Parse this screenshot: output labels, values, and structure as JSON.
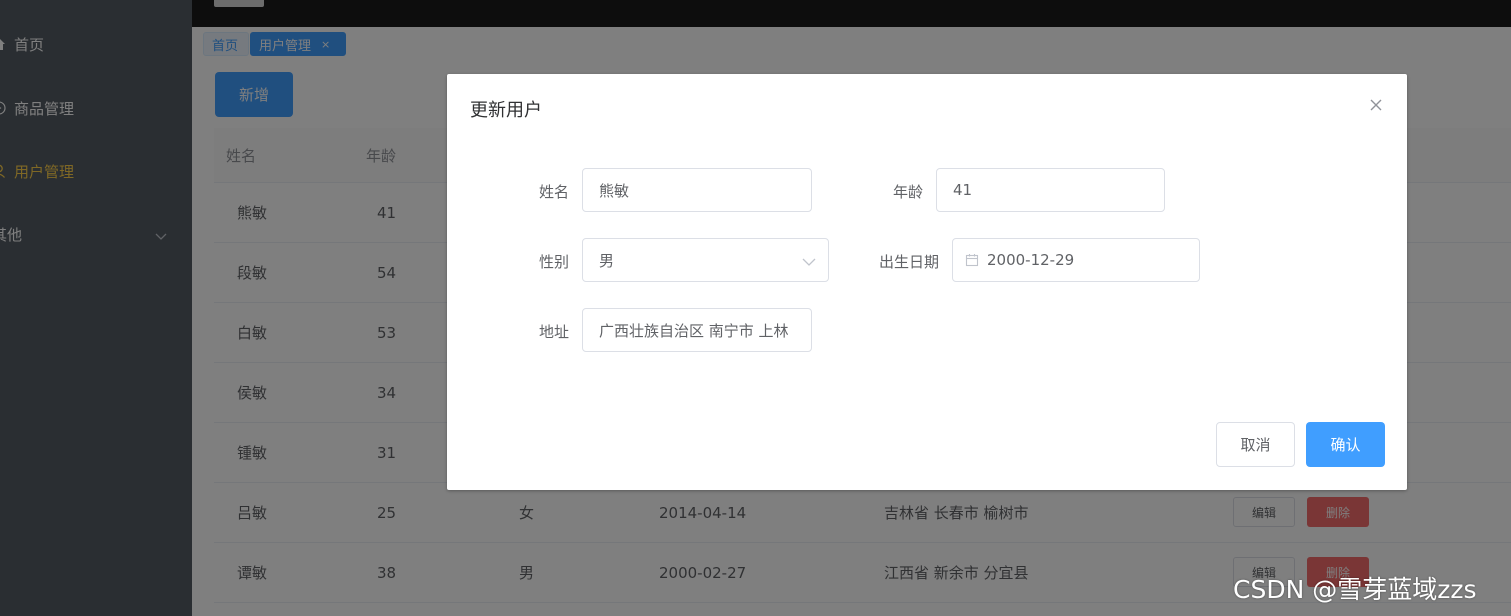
{
  "sidebar": {
    "items": [
      {
        "label": "首页",
        "icon": "home-icon"
      },
      {
        "label": "商品管理",
        "icon": "play-circle-icon"
      },
      {
        "label": "用户管理",
        "icon": "user-icon",
        "active": true
      },
      {
        "label": "其他",
        "icon": "chevron-down-icon"
      }
    ]
  },
  "tabs": {
    "home": "首页",
    "user": "用户管理",
    "close": "×"
  },
  "toolbar": {
    "add_label": "新增"
  },
  "table": {
    "headers": {
      "name": "姓名",
      "age": "年龄"
    },
    "rows": [
      {
        "name": "熊敏",
        "age": "41"
      },
      {
        "name": "段敏",
        "age": "54"
      },
      {
        "name": "白敏",
        "age": "53"
      },
      {
        "name": "侯敏",
        "age": "34"
      },
      {
        "name": "锺敏",
        "age": "31"
      },
      {
        "name": "吕敏",
        "age": "25",
        "sex": "女",
        "birth": "2014-04-14",
        "addr": "吉林省 长春市 榆树市",
        "edit": "编辑",
        "del": "删除"
      },
      {
        "name": "谭敏",
        "age": "38",
        "sex": "男",
        "birth": "2000-02-27",
        "addr": "江西省 新余市 分宜县",
        "edit": "编辑",
        "del": "删除"
      }
    ]
  },
  "dialog": {
    "title": "更新用户",
    "fields": {
      "name_label": "姓名",
      "name_value": "熊敏",
      "age_label": "年龄",
      "age_value": "41",
      "sex_label": "性别",
      "sex_value": "男",
      "birth_label": "出生日期",
      "birth_value": "2000-12-29",
      "addr_label": "地址",
      "addr_value": "广西壮族自治区 南宁市 上林"
    },
    "cancel_label": "取消",
    "confirm_label": "确认"
  },
  "watermark": "CSDN @雪芽蓝域zzs",
  "colors": {
    "primary": "#409eff",
    "danger": "#f56c6c",
    "sidebar": "#545c64",
    "active": "#ffd04b"
  }
}
